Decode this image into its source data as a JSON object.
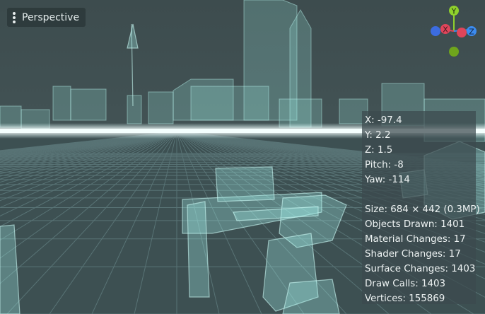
{
  "view_menu": {
    "label": "Perspective"
  },
  "camera": {
    "x": "X: -97.4",
    "y": "Y: 2.2",
    "z": "Z: 1.5",
    "pitch": "Pitch: -8",
    "yaw": "Yaw: -114"
  },
  "stats": {
    "size": "Size: 684 × 442 (0.3MP)",
    "objects_drawn": "Objects Drawn: 1401",
    "material_changes": "Material Changes: 17",
    "shader_changes": "Shader Changes: 17",
    "surface_changes": "Surface Changes: 1403",
    "draw_calls": "Draw Calls: 1403",
    "vertices": "Vertices: 155869"
  },
  "gizmo": {
    "y_label": "Y",
    "x_label": "X",
    "z_label": "Z",
    "colors": {
      "x": "#e0455a",
      "y": "#8fd12c",
      "z": "#3c8cf0"
    }
  },
  "colors": {
    "background": "#3a4a4c",
    "grid": "#6c8c8e",
    "geometry": "#9ff0ea",
    "horizon_glow": "#dffffd"
  }
}
